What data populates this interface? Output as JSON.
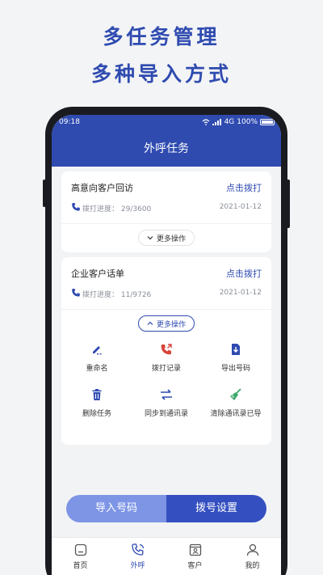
{
  "headline": {
    "line1": "多任务管理",
    "line2": "多种导入方式"
  },
  "status_bar": {
    "time": "09:18",
    "network": "4G",
    "battery": "100%"
  },
  "nav": {
    "title": "外呼任务"
  },
  "tasks": [
    {
      "title": "高意向客户回访",
      "dial_label": "点击拨打",
      "progress_label": "拨打进度：",
      "progress_value": "29/3600",
      "date": "2021-01-12",
      "more_label": "更多操作"
    },
    {
      "title": "企业客户话单",
      "dial_label": "点击拨打",
      "progress_label": "拨打进度：",
      "progress_value": "11/9726",
      "date": "2021-01-12",
      "more_label": "更多操作"
    }
  ],
  "actions": [
    {
      "label": "重命名",
      "icon": "edit-icon"
    },
    {
      "label": "拨打记录",
      "icon": "call-log-icon"
    },
    {
      "label": "导出号码",
      "icon": "export-icon"
    },
    {
      "label": "删除任务",
      "icon": "trash-icon"
    },
    {
      "label": "同步到通讯录",
      "icon": "sync-icon"
    },
    {
      "label": "清除通讯录已导",
      "icon": "broom-icon"
    }
  ],
  "bottom_buttons": {
    "import": "导入号码",
    "settings": "拨号设置"
  },
  "tabs": [
    {
      "label": "首页",
      "icon": "home-icon",
      "active": false
    },
    {
      "label": "外呼",
      "icon": "phone-icon",
      "active": true
    },
    {
      "label": "客户",
      "icon": "contacts-icon",
      "active": false
    },
    {
      "label": "我的",
      "icon": "user-icon",
      "active": false
    }
  ],
  "colors": {
    "primary": "#2f4bb0",
    "light_primary": "#7e95e6",
    "red_icon": "#d9443a",
    "green_icon": "#3aa86b"
  }
}
